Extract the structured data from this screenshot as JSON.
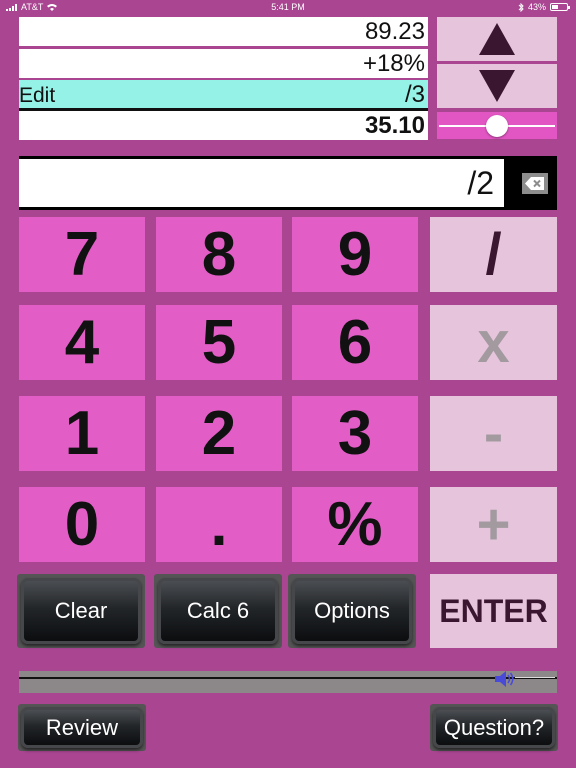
{
  "status_bar": {
    "carrier": "AT&T",
    "time": "5:41 PM",
    "battery": "43%"
  },
  "tape": {
    "value1": "89.23",
    "value2": "+18%",
    "edit_label": "Edit",
    "edit_value": "/3",
    "total": "35.10"
  },
  "entry": {
    "value": "/2"
  },
  "keys": {
    "k7": "7",
    "k8": "8",
    "k9": "9",
    "divide": "/",
    "k4": "4",
    "k5": "5",
    "k6": "6",
    "multiply": "x",
    "k1": "1",
    "k2": "2",
    "k3": "3",
    "subtract": "-",
    "k0": "0",
    "dot": ".",
    "percent": "%",
    "add": "+"
  },
  "buttons": {
    "clear": "Clear",
    "calc": "Calc 6",
    "options": "Options",
    "enter": "ENTER",
    "review": "Review",
    "question": "Question?"
  },
  "controls": {
    "slider_level": 0.5,
    "volume_level": 0.91
  },
  "colors": {
    "background": "#a94591",
    "key": "#e25ec6",
    "operator": "#e6c5dc",
    "edit_highlight": "#95f2e6",
    "volume_icon": "#4a4ad8"
  }
}
